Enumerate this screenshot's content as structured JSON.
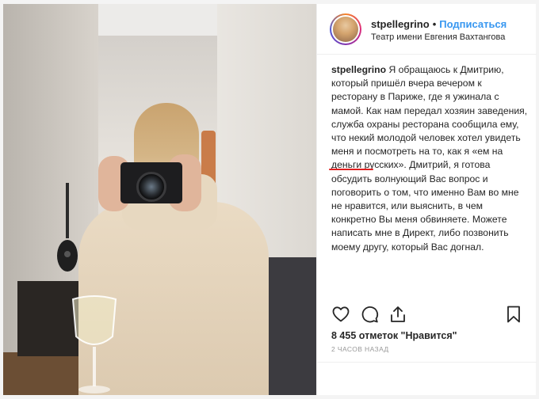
{
  "post": {
    "username": "stpellegrino",
    "separator": "•",
    "follow_label": "Подписаться",
    "location": "Театр имени Евгения Вахтангова"
  },
  "caption": {
    "username": "stpellegrino",
    "text_part1": " Я обращаюсь к Дмитрию, который пришёл вчера вечером к ресторану в Париже, где я ужинала с мамой. Как нам передал хозяин заведения, служба охраны ресторана сообщила ему, что некий молодой человек хотел увидеть меня и посмотреть на то, как я «ем на деньги русских». ",
    "mention": "Дмитрий",
    "text_part2": ", я готова обсудить волнующий Вас вопрос и поговорить о том, что именно Вам во мне не нравится, или выяснить, в чем конкретно Вы меня обвиняете. Можете написать мне в Директ, либо позвонить моему другу, который Вас догнал."
  },
  "actions": {
    "like_icon": "heart-icon",
    "comment_icon": "comment-icon",
    "share_icon": "share-icon",
    "save_icon": "bookmark-icon"
  },
  "likes_text": "8 455 отметок \"Нравится\"",
  "time_text": "2 ЧАСОВ НАЗАД",
  "colors": {
    "follow": "#3897f0",
    "highlight": "#e02020",
    "text": "#262626",
    "muted": "#999999"
  }
}
